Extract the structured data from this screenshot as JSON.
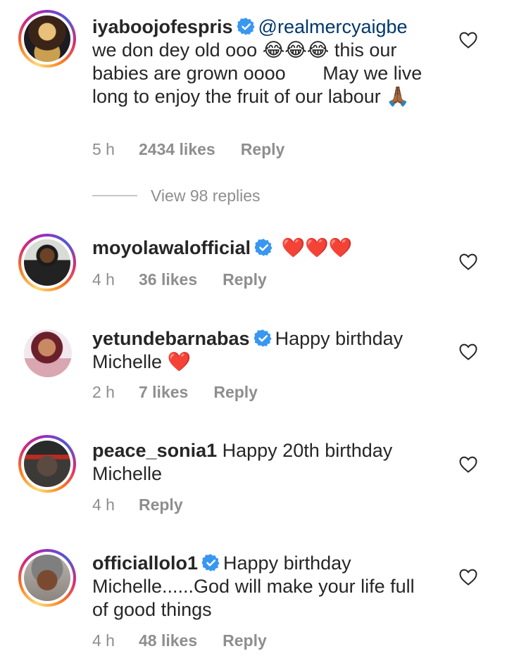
{
  "comments": [
    {
      "username": "iyaboojofespris",
      "verified": true,
      "mention": "@realmercyaigbe",
      "line1": "we don dey old ooo",
      "emoji1": "😂😂😂",
      "line1b": "this our",
      "line2": "babies are grown oooo",
      "line2b": "May we live",
      "line3": "long to enjoy the fruit of our labour",
      "emoji2": "🙏🏾",
      "time": "5 h",
      "likes": "2434 likes",
      "reply": "Reply"
    },
    {
      "username": "moyolawalofficial",
      "verified": true,
      "emoji": "❤️❤️❤️",
      "time": "4 h",
      "likes": "36 likes",
      "reply": "Reply"
    },
    {
      "username": "yetundebarnabas",
      "verified": true,
      "text1": "Happy birthday",
      "text2": "Michelle",
      "emoji": "❤️",
      "time": "2 h",
      "likes": "7 likes",
      "reply": "Reply"
    },
    {
      "username": "peace_sonia1",
      "verified": false,
      "text1": "Happy 20th birthday",
      "text2": "Michelle",
      "time": "4 h",
      "reply": "Reply"
    },
    {
      "username": "officiallolo1",
      "verified": true,
      "text1": "Happy birthday",
      "text2": "Michelle......God will make your life full",
      "text3": "of good things",
      "time": "4 h",
      "likes": "48 likes",
      "reply": "Reply"
    }
  ],
  "view_replies": "View 98 replies",
  "icons": {
    "verified": "verified-badge-icon",
    "like": "heart-outline-icon"
  },
  "colors": {
    "verified": "#3897f0",
    "muted": "#8e8e8e",
    "mention": "#00376b"
  }
}
